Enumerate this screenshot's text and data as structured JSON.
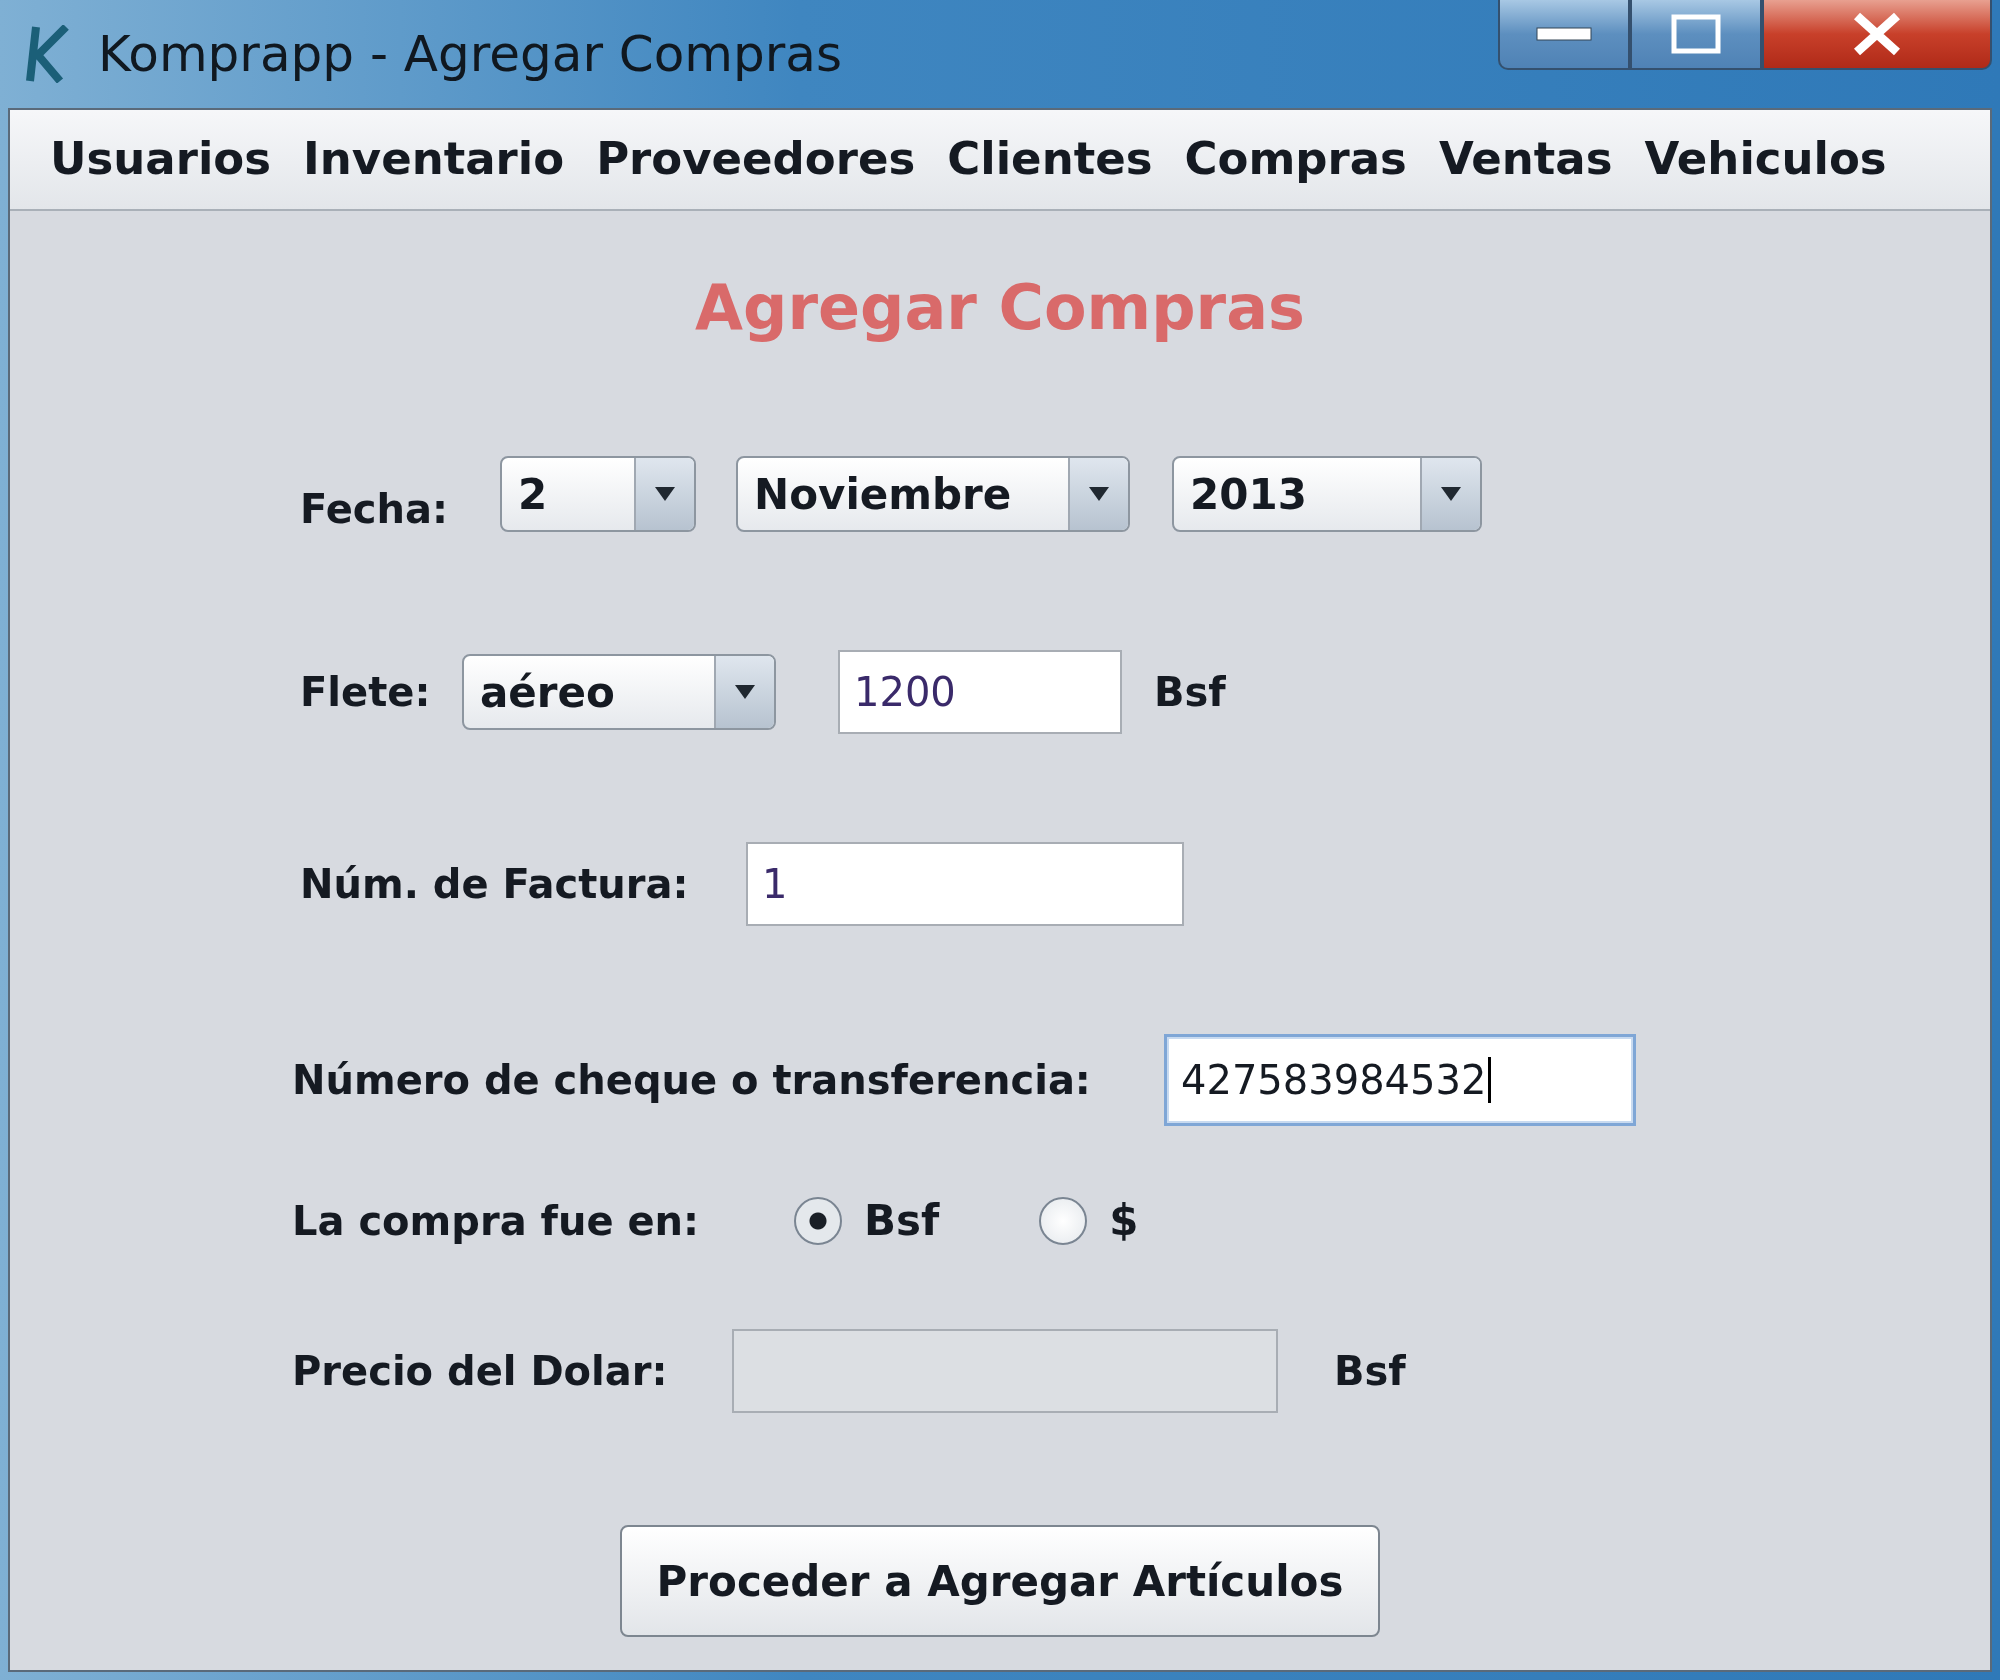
{
  "window": {
    "title": "Komprapp - Agregar Compras"
  },
  "menu": [
    {
      "label": "Usuarios"
    },
    {
      "label": "Inventario"
    },
    {
      "label": "Proveedores"
    },
    {
      "label": "Clientes"
    },
    {
      "label": "Compras"
    },
    {
      "label": "Ventas"
    },
    {
      "label": "Vehiculos"
    }
  ],
  "heading": "Agregar Compras",
  "date": {
    "label": "Fecha:",
    "day": "2",
    "month": "Noviembre",
    "year": "2013"
  },
  "freight": {
    "label": "Flete:",
    "type": "aéreo",
    "amount": "1200",
    "unit": "Bsf"
  },
  "invoice": {
    "label": "Núm. de Factura:",
    "value": "1"
  },
  "payment_ref": {
    "label": "Número de cheque o transferencia:",
    "value": "427583984532",
    "focused": true
  },
  "currency": {
    "label": "La compra fue en:",
    "options": [
      {
        "label": "Bsf",
        "selected": true
      },
      {
        "label": "$",
        "selected": false
      }
    ]
  },
  "dollar_price": {
    "label": "Precio del Dolar:",
    "disabled": true,
    "unit": "Bsf"
  },
  "button": "Proceder a Agregar Artículos"
}
